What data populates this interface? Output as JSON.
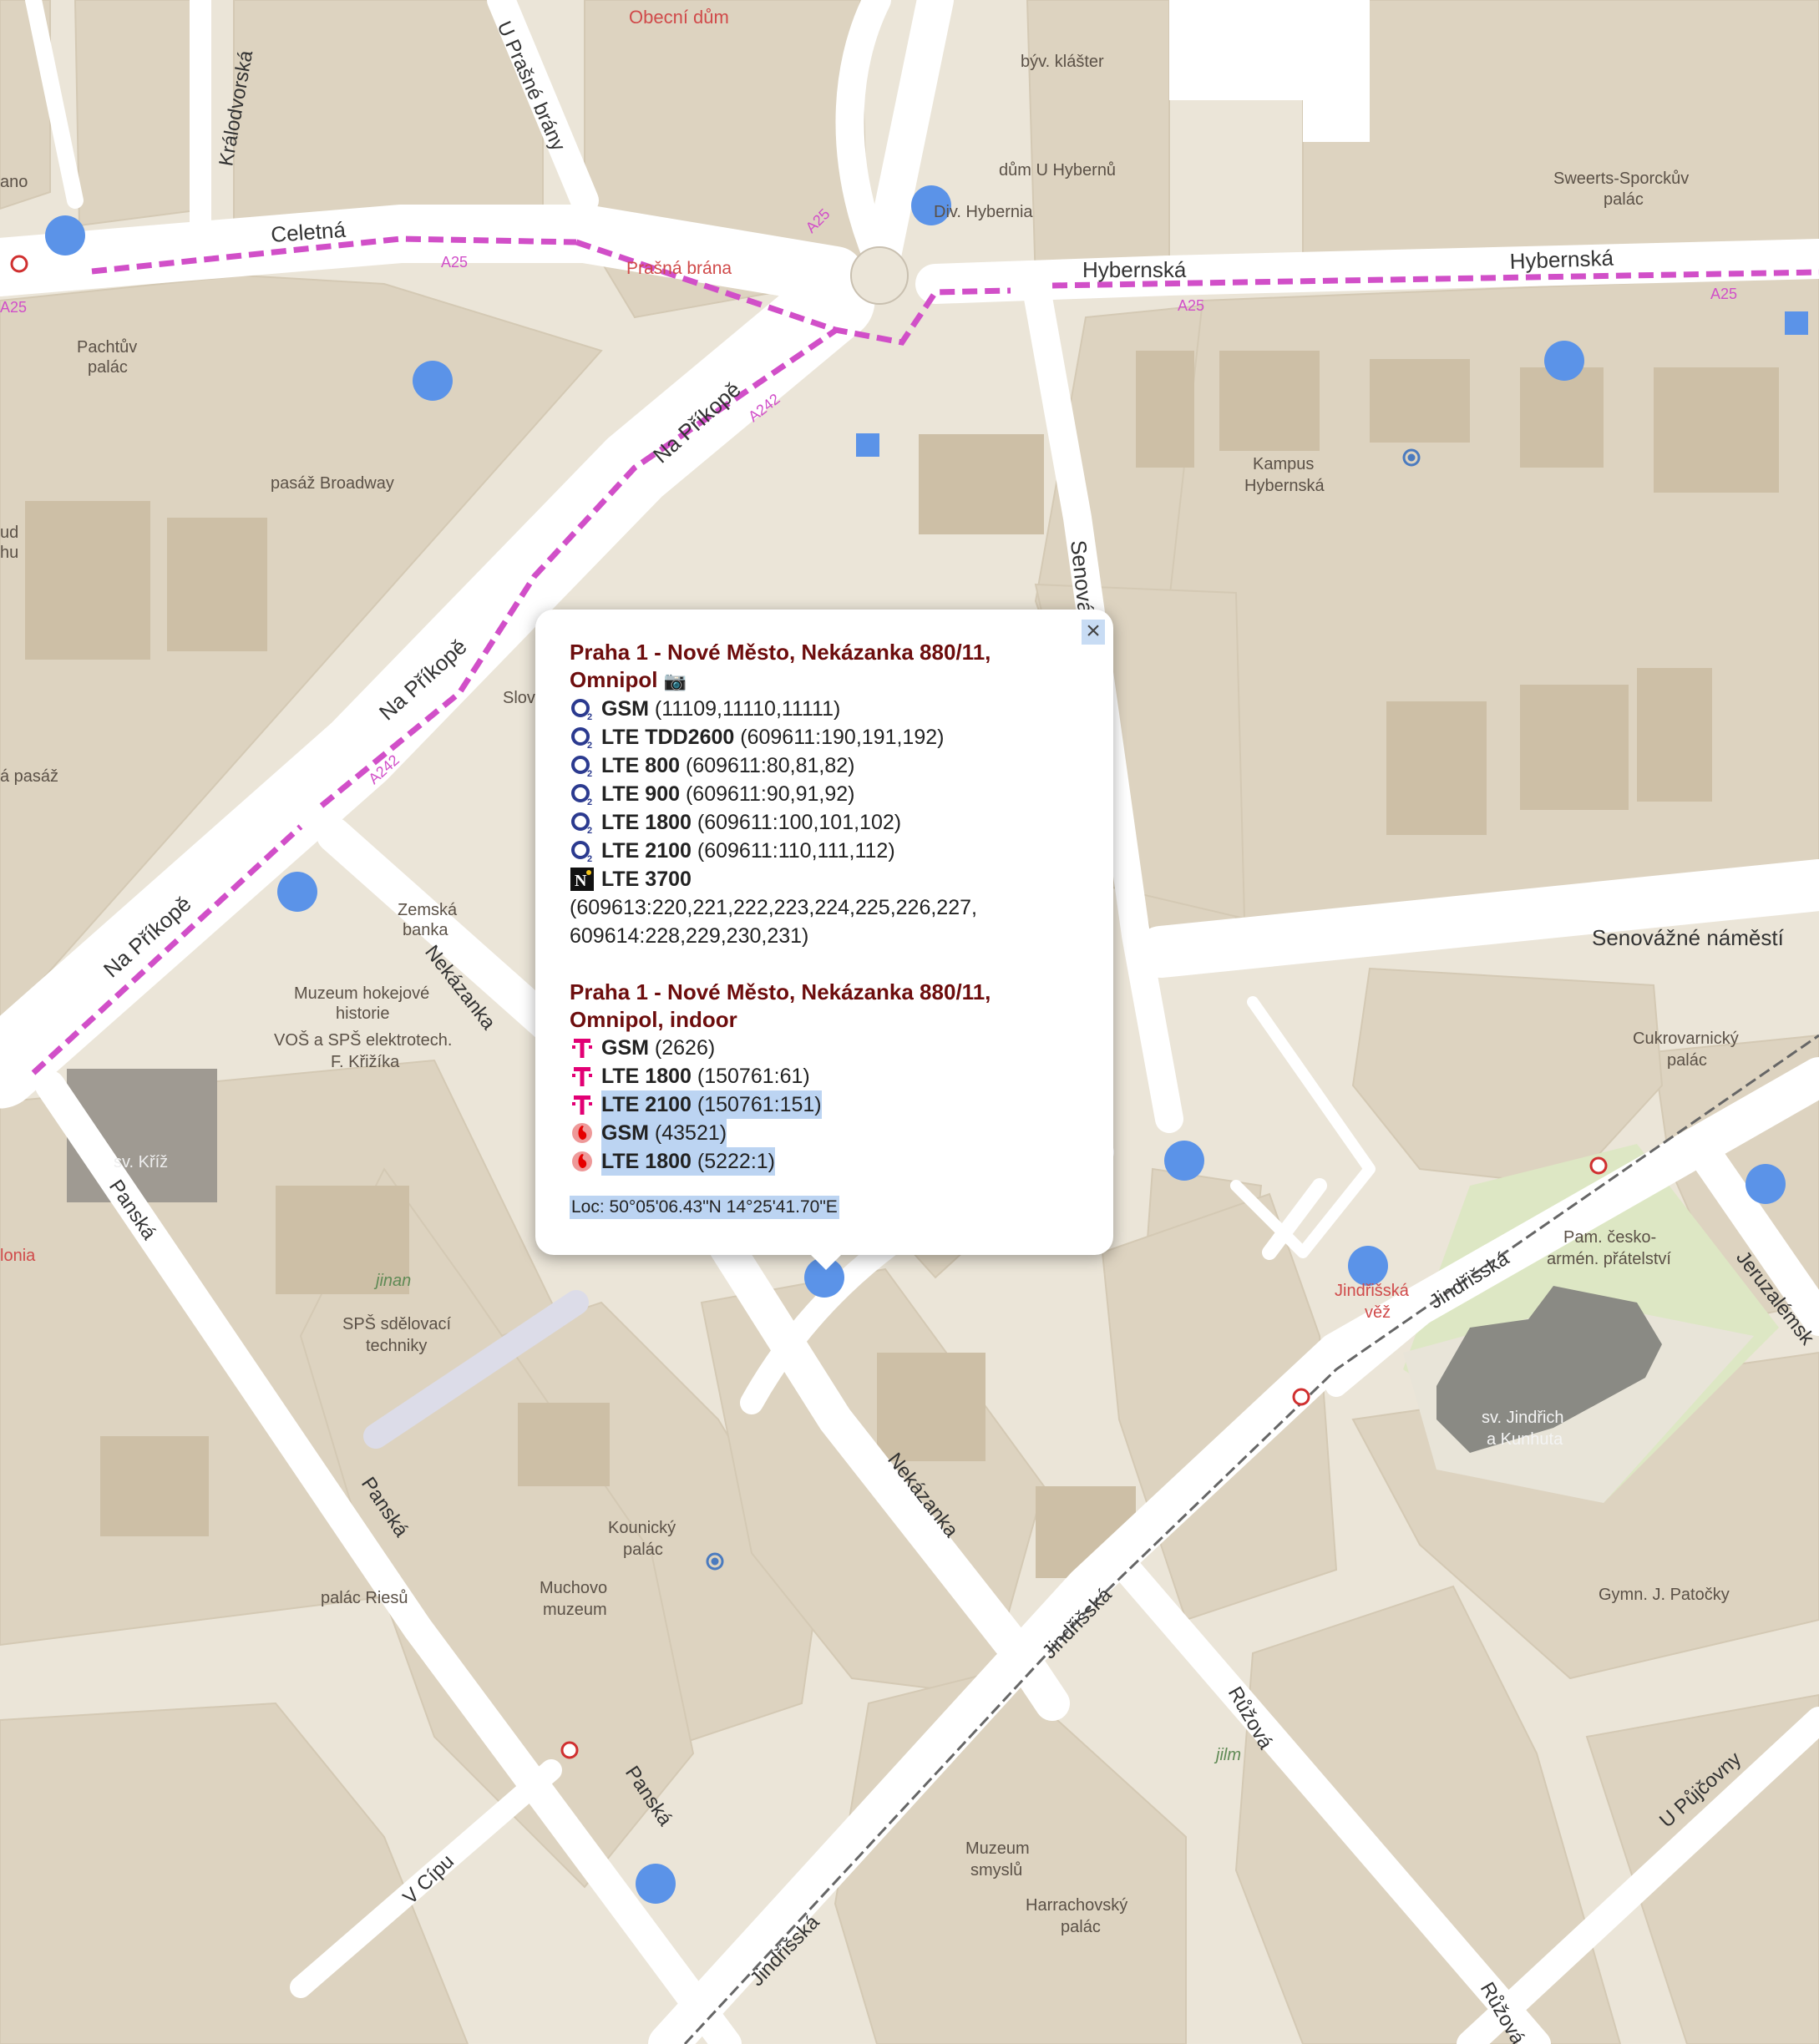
{
  "map": {
    "labels": {
      "obecni_dum": "Obecní dům",
      "byv_klaster": "býv. klášter",
      "dum_u_hybernu": "dům U Hybernů",
      "div_hybernia": "Div. Hybernia",
      "sweerts": "Sweerts-Sporckův",
      "sweerts2": "palác",
      "celetna": "Celetná",
      "kralodvorska": "Králodvorská",
      "u_prasne_brany": "U Prašné brány",
      "prasna_brana": "Prašná brána",
      "hybernska_1": "Hybernská",
      "hybernska_2": "Hybernská",
      "pachtuv": "Pachtův",
      "pachtuv2": "palác",
      "pasaz_broadway": "pasáž Broadway",
      "na_prikope_1": "Na Příkopě",
      "na_prikope_2": "Na Příkopě",
      "na_prikope_3": "Na Příkopě",
      "kampus": "Kampus",
      "kampus2": "Hybernská",
      "senovazna": "Senovážná",
      "senovazne_namesti": "Senovážné náměstí",
      "zemska_banka": "Zemská",
      "zemska_banka2": "banka",
      "nekazanka_1": "Nekázanka",
      "nekazanka_2": "Nekázanka",
      "muzeum_hokej": "Muzeum hokejové",
      "muzeum_hokej2": "historie",
      "vos_sps": "VOŠ a SPŠ elektrotech.",
      "vos_sps2": "F. Křižíka",
      "sv_kriz": "sv. Kříž",
      "panska_1": "Panská",
      "panska_2": "Panská",
      "panska_3": "Panská",
      "jinan": "jinan",
      "sps_sdel": "SPŠ sdělovací",
      "sps_sdel2": "techniky",
      "cukrovarnicky": "Cukrovarnický",
      "cukrovarnicky2": "palác",
      "jindrisska_vez": "Jindřišská",
      "jindrisska_vez2": "věž",
      "jindrisska_1": "Jindřišská",
      "jindrisska_2": "Jindřišská",
      "jindrisska_3": "Jindřišská",
      "pam_cesko": "Pam. česko-",
      "pam_cesko2": "armén. přátelství",
      "jeruzalemska": "Jeruzalémsk",
      "sv_jindrich": "sv. Jindřich",
      "sv_jindrich2": "a Kunhuta",
      "kounicky": "Kounický",
      "kounicky2": "palác",
      "muchovo": "Muchovo",
      "muchovo2": "muzeum",
      "palac_riesu": "palác Riesů",
      "gymn": "Gymn. J. Patočky",
      "ruzova_1": "Růžová",
      "ruzova_2": "Růžová",
      "u_pujcovny": "U Půjčovny",
      "v_cipu": "V Cípu",
      "jilm": "jilm",
      "muzeum_smyslu": "Muzeum",
      "muzeum_smyslu2": "smyslů",
      "harrachovsky": "Harrachovský",
      "harrachovsky2": "palác",
      "slov": "Slov",
      "ano": "ano",
      "ud": "ud",
      "hu": "hu",
      "a_pasaz": "á pasáž",
      "lonia": "lonia",
      "a25_1": "A25",
      "a25_2": "A25",
      "a25_3": "A25",
      "a25_4": "A25",
      "a25_5": "A25",
      "a242_1": "A242",
      "a242_2": "A242"
    }
  },
  "popup": {
    "close_label": "×",
    "site1": {
      "title_line1": "Praha 1 - Nové Město, Nekázanka 880/11,",
      "title_line2": "Omnipol",
      "camera_icon": "📷",
      "rows": [
        {
          "tech": "GSM",
          "ids": "(11109,11110,11111)"
        },
        {
          "tech": "LTE TDD2600",
          "ids": "(609611:190,191,192)"
        },
        {
          "tech": "LTE 800",
          "ids": "(609611:80,81,82)"
        },
        {
          "tech": "LTE 900",
          "ids": "(609611:90,91,92)"
        },
        {
          "tech": "LTE 1800",
          "ids": "(609611:100,101,102)"
        },
        {
          "tech": "LTE 2100",
          "ids": "(609611:110,111,112)"
        }
      ],
      "nordic_row": {
        "tech": "LTE 3700",
        "ids_line1": "(609613:220,221,222,223,224,225,226,227,",
        "ids_line2": "609614:228,229,230,231)"
      }
    },
    "site2": {
      "title_line1": "Praha 1 - Nové Město, Nekázanka 880/11,",
      "title_line2": "Omnipol, indoor",
      "tmobile_rows": [
        {
          "tech": "GSM",
          "ids": "(2626)"
        },
        {
          "tech": "LTE 1800",
          "ids": "(150761:61)"
        },
        {
          "tech": "LTE 2100",
          "ids": "(150761:151)"
        }
      ],
      "vodafone_rows": [
        {
          "tech": "GSM",
          "ids": "(43521)"
        },
        {
          "tech": "LTE 1800",
          "ids": "(5222:1)"
        }
      ]
    },
    "loc": "Loc: 50°05'06.43\"N 14°25'41.70\"E"
  },
  "icons": {
    "o2": "o2-logo-icon",
    "nordic": "nordic-telecom-icon",
    "tmobile": "t-mobile-icon",
    "vodafone": "vodafone-icon",
    "camera": "camera-icon",
    "close": "close-icon"
  },
  "colors": {
    "marker": "#5b93e8",
    "cycle_route": "#d14fc8",
    "popup_title": "#6d0d0d",
    "selection": "#bcd4f2",
    "o2": "#2b3a8f",
    "tmobile": "#e20074",
    "vodafone": "#e60000"
  }
}
